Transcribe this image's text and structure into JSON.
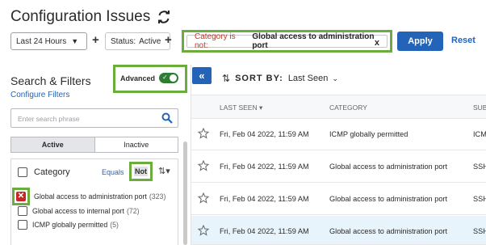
{
  "page": {
    "title": "Configuration Issues",
    "refresh_icon": "refresh-icon"
  },
  "filter_bar": {
    "time_range": "Last 24 Hours",
    "status_label": "Status:",
    "status_value": "Active",
    "chip_key": "Category is not:",
    "chip_value": "Global access to administration port",
    "chip_close": "x",
    "apply_label": "Apply",
    "reset_label": "Reset",
    "plus": "+"
  },
  "sidebar": {
    "title": "Search & Filters",
    "configure_link": "Configure Filters",
    "advanced_label": "Advanced",
    "search_placeholder": "Enter search phrase",
    "tabs": [
      "Active",
      "Inactive"
    ],
    "category_heading": "Category",
    "equals_label": "Equals",
    "not_label": "Not",
    "options": [
      {
        "label": "Global access to administration port",
        "count": "(323)",
        "checked": true
      },
      {
        "label": "Global access to internal port",
        "count": "(72)",
        "checked": false
      },
      {
        "label": "ICMP globally permitted",
        "count": "(5)",
        "checked": false
      }
    ]
  },
  "main": {
    "collapse_icon": "double-chevron-left-icon",
    "sort_by_label": "SORT BY:",
    "sort_by_value": "Last Seen",
    "columns": [
      "LAST SEEN",
      "CATEGORY",
      "SUB"
    ],
    "rows": [
      {
        "last_seen": "Fri, Feb 04 2022, 11:59 AM",
        "category": "ICMP globally permitted",
        "sub": "ICM"
      },
      {
        "last_seen": "Fri, Feb 04 2022, 11:59 AM",
        "category": "Global access to administration port",
        "sub": "SSH"
      },
      {
        "last_seen": "Fri, Feb 04 2022, 11:59 AM",
        "category": "Global access to administration port",
        "sub": "SSH"
      },
      {
        "last_seen": "Fri, Feb 04 2022, 11:59 AM",
        "category": "Global access to administration port",
        "sub": "SSH"
      }
    ]
  },
  "colors": {
    "accent": "#2363b8",
    "highlight": "#6aad3c",
    "chip_key": "#c0392b",
    "toggle_on": "#2e7d32",
    "checked_red": "#c62828",
    "selected_row": "#e8f4fb"
  }
}
